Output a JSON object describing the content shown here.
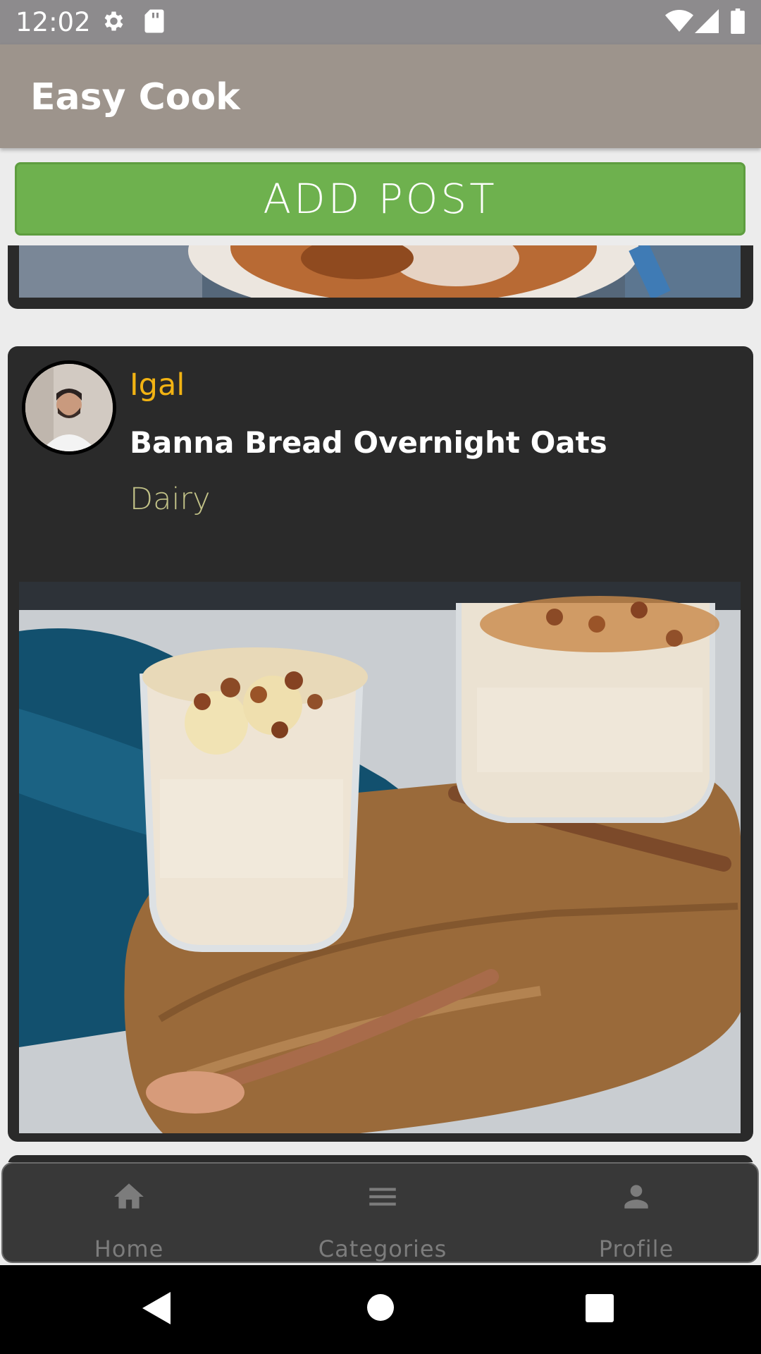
{
  "status_bar": {
    "time": "12:02",
    "icons": [
      "gear-icon",
      "sd-card-icon",
      "wifi-icon",
      "signal-icon",
      "battery-icon"
    ]
  },
  "app_bar": {
    "title": "Easy Cook"
  },
  "actions": {
    "add_post_label": "ADD POST"
  },
  "feed": {
    "posts": [
      {
        "author": "Igal",
        "title": "Banna Bread Overnight Oats",
        "category": "Dairy"
      }
    ]
  },
  "bottom_nav": {
    "items": [
      {
        "label": "Home",
        "icon": "home-icon"
      },
      {
        "label": "Categories",
        "icon": "menu-icon"
      },
      {
        "label": "Profile",
        "icon": "person-icon"
      }
    ]
  },
  "colors": {
    "app_bar": "#9d948c",
    "add_post": "#6eb14e",
    "card": "#2a2a2a",
    "author": "#f2b313",
    "category": "#c3c388",
    "nav_bg": "#383838"
  }
}
